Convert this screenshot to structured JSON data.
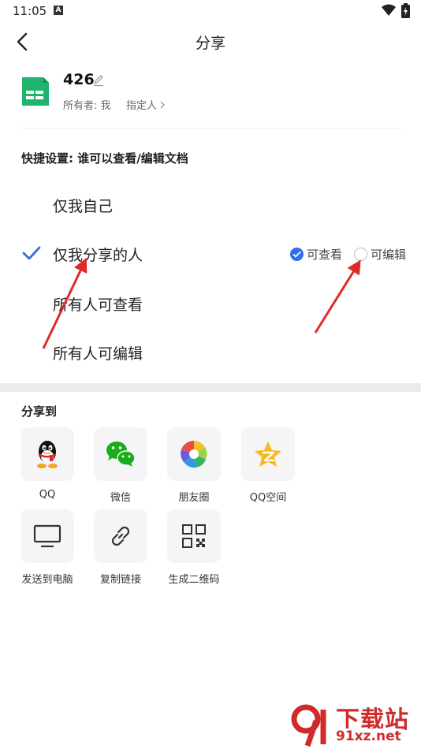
{
  "status_bar": {
    "time": "11:05",
    "notification_badge": "A"
  },
  "nav": {
    "title": "分享",
    "back_icon": "chevron-left-icon"
  },
  "document": {
    "name": "426",
    "owner_label": "所有者: 我",
    "assign_label": "指定人",
    "icon_color": "#1fb46b"
  },
  "quick_settings": {
    "title": "快捷设置: 谁可以查看/编辑文档",
    "options": [
      {
        "label": "仅我自己",
        "selected": false
      },
      {
        "label": "仅我分享的人",
        "selected": true
      },
      {
        "label": "所有人可查看",
        "selected": false
      },
      {
        "label": "所有人可编辑",
        "selected": false
      }
    ],
    "permissions": {
      "view_label": "可查看",
      "view_checked": true,
      "edit_label": "可编辑",
      "edit_checked": false
    }
  },
  "share_to": {
    "title": "分享到",
    "targets": [
      {
        "label": "QQ",
        "icon": "qq-penguin-icon"
      },
      {
        "label": "微信",
        "icon": "wechat-icon"
      },
      {
        "label": "朋友圈",
        "icon": "moments-icon"
      },
      {
        "label": "QQ空间",
        "icon": "qzone-star-icon"
      },
      {
        "label": "发送到电脑",
        "icon": "monitor-icon"
      },
      {
        "label": "复制链接",
        "icon": "link-icon"
      },
      {
        "label": "生成二维码",
        "icon": "qr-code-icon"
      }
    ]
  },
  "watermark": {
    "brand": "下载站",
    "url": "91xz.net"
  },
  "colors": {
    "accent": "#2f6fe8",
    "arrow": "#e02a2a",
    "divider": "#ebebeb"
  }
}
